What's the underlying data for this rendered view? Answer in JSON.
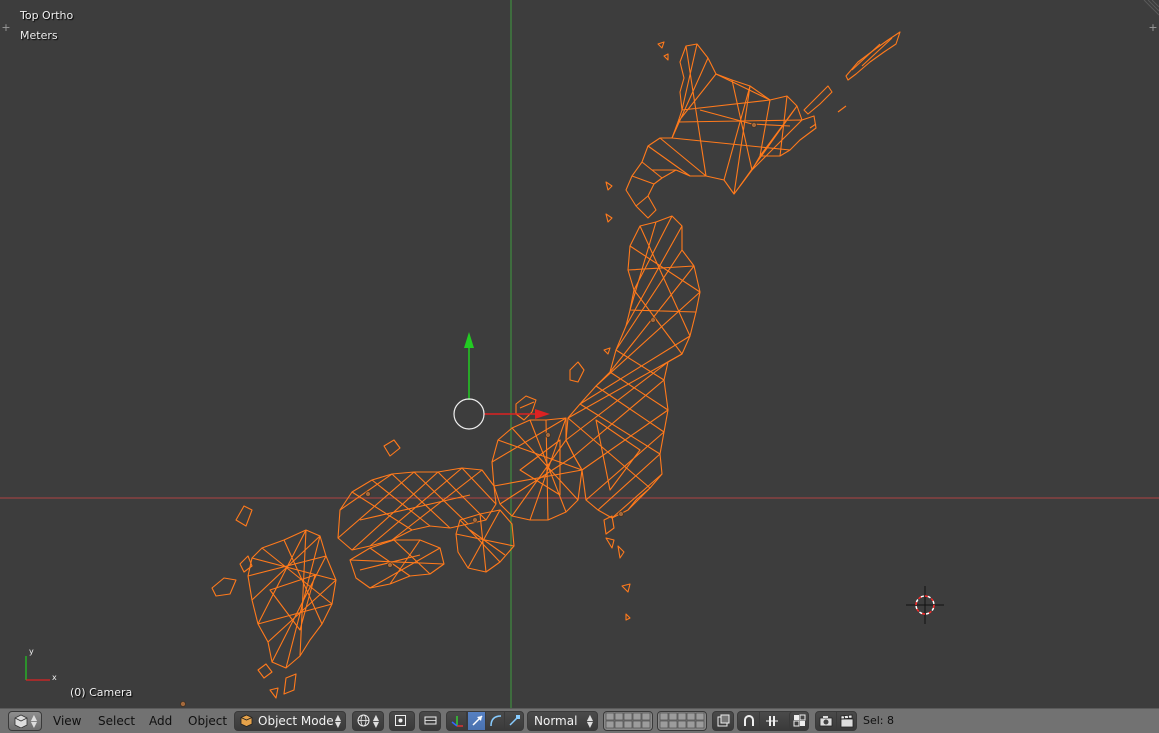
{
  "viewport": {
    "view_name": "Top Ortho",
    "units": "Meters",
    "object_info": "(0) Camera"
  },
  "header": {
    "menus": [
      "View",
      "Select",
      "Add",
      "Object"
    ],
    "mode": "Object Mode",
    "pivot_orientation": "Normal",
    "selection_info": "Sel: 8"
  },
  "icons": {
    "editor_type": "cube-icon",
    "mode": "cube-icon",
    "shading": "sphere-icon",
    "pivot": "pivot-icon",
    "manipulator": "manipulator-icon",
    "translate": "arrow-icon",
    "rotate": "arc-icon",
    "scale": "scale-icon",
    "layers": "layer-grid-icon",
    "lock": "lock-icon",
    "snap": "magnet-icon",
    "snap_element": "snap-element-icon",
    "render": "camera-icon",
    "render_anim": "clapper-icon"
  },
  "colors": {
    "background": "#3d3d3d",
    "mesh_wire": "#ff7a1c",
    "x_axis": "#c24545",
    "y_axis": "#3fae3f",
    "header": "#727272"
  }
}
